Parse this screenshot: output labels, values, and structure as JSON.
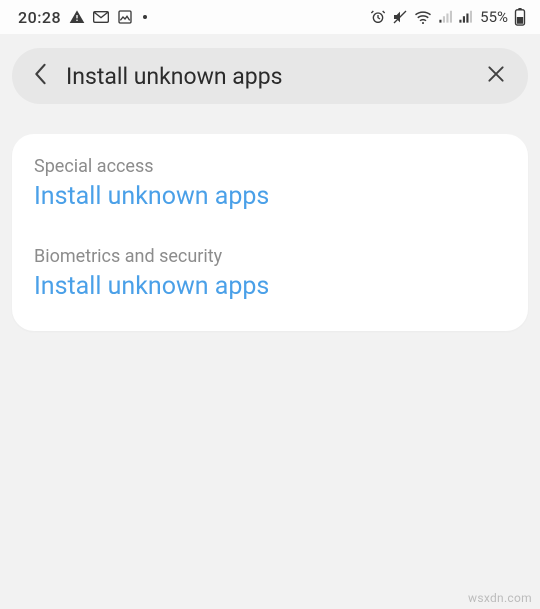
{
  "status": {
    "time": "20:28",
    "battery_pct": "55%"
  },
  "search": {
    "query": "Install unknown apps"
  },
  "results": [
    {
      "path": "Special access",
      "title": "Install unknown apps"
    },
    {
      "path": "Biometrics and security",
      "title": "Install unknown apps"
    }
  ],
  "watermark": "wsxdn.com"
}
